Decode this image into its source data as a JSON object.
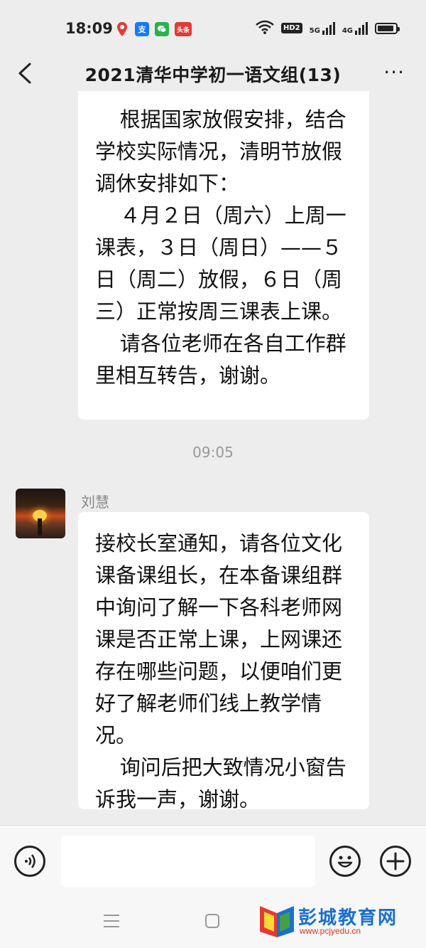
{
  "status_bar": {
    "time": "18:09",
    "left_icons": [
      "location-icon",
      "alipay-icon",
      "wechat-icon",
      "toutiao-icon"
    ],
    "toutiao_label": "头条",
    "hd_label": "HD2",
    "net1": "5G",
    "net2": "4G"
  },
  "nav": {
    "title": "2021清华中学初一语文组(13)",
    "more_label": "···"
  },
  "messages": [
    {
      "paragraphs": [
        "根据国家放假安排，结合学校实际情况，清明节放假调休安排如下：",
        "４月２日（周六）上周一课表，３日（周日）——５日（周二）放假，６日（周三）正常按周三课表上课。",
        "请各位老师在各自工作群里相互转告，谢谢。"
      ]
    },
    {
      "timestamp": "09:05",
      "sender": "刘慧",
      "paragraphs": [
        "接校长室通知，请各位文化课备课组长，在本备课组群中询问了解一下各科老师网课是否正常上课，上网课还存在哪些问题，以便咱们更好了解老师们线上教学情况。",
        "询问后把大致情况小窗告诉我一声，谢谢。"
      ]
    }
  ],
  "watermark": {
    "text": "彭城教育网",
    "url": "www.pcjyedu.cn"
  },
  "colors": {
    "background": "#ededed",
    "bubble": "#ffffff",
    "watermark_blue": "#1a6fd0"
  }
}
